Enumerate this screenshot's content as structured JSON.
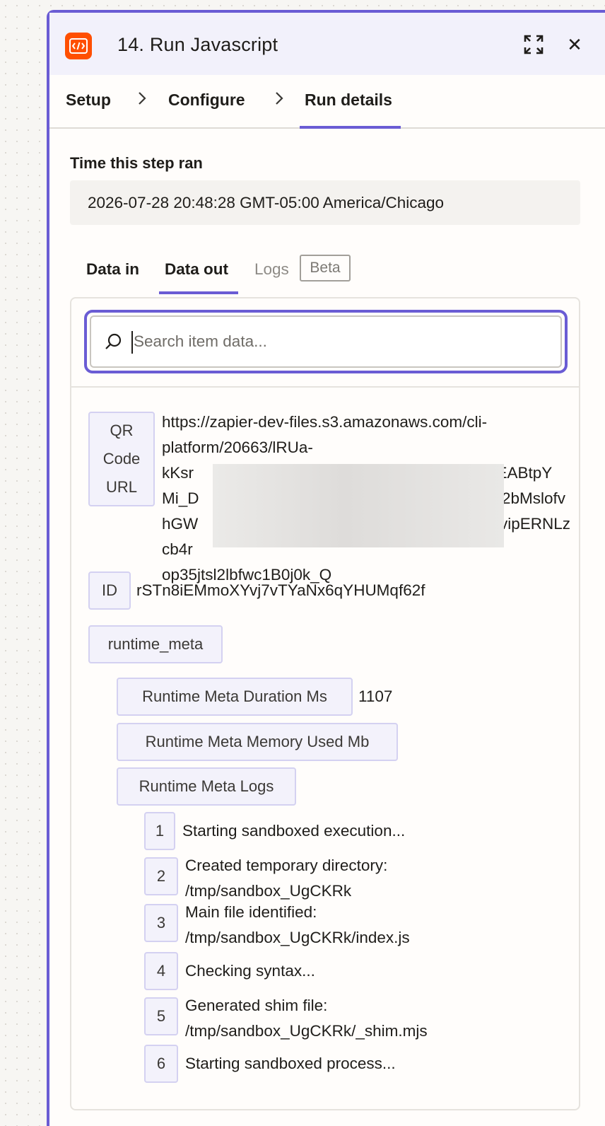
{
  "header": {
    "title": "14. Run Javascript",
    "close_glyph": "✕",
    "app_icon": "code-icon",
    "accent": "#6a5cd4",
    "brand": "#ff4f00"
  },
  "steps": [
    {
      "label": "Setup"
    },
    {
      "label": "Configure"
    },
    {
      "label": "Run details",
      "active": true
    }
  ],
  "run": {
    "time_label": "Time this step ran",
    "time_value": "2026-07-28 20:48:28 GMT-05:00 America/Chicago"
  },
  "data_tabs": {
    "data_in": "Data in",
    "data_out": "Data out",
    "logs": "Logs",
    "beta": "Beta",
    "active": "data_out"
  },
  "search": {
    "placeholder": "Search item data..."
  },
  "items": {
    "qr_key_lines": [
      "QR",
      "Code",
      "URL"
    ],
    "qr_value_lines": [
      "https://zapier-dev-files.s3.amazonaws.com/cli-",
      "platform/20663/lRUa-",
      "kKsr",
      "Mi_D",
      "hGW",
      "cb4r",
      "op35jtsl2lbfwc1B0j0k_Q"
    ],
    "qr_value_right": [
      "laEABtpY",
      "l2bMslofv",
      "vipERNLz"
    ],
    "id_key": "ID",
    "id_value": "rSTn8iEMmoXYvj7vTYaNx6qYHUMqf62f",
    "runtime_key": "runtime_meta",
    "duration_key": "Runtime Meta Duration Ms",
    "duration_value": "1107",
    "memory_key": "Runtime Meta Memory Used Mb",
    "logs_key": "Runtime Meta Logs",
    "logs": [
      {
        "index": "1",
        "lines": [
          "Starting sandboxed execution..."
        ]
      },
      {
        "index": "2",
        "lines": [
          "Created temporary directory:",
          "/tmp/sandbox_UgCKRk"
        ]
      },
      {
        "index": "3",
        "lines": [
          "Main file identified:",
          "/tmp/sandbox_UgCKRk/index.js"
        ]
      },
      {
        "index": "4",
        "lines": [
          "Checking syntax..."
        ]
      },
      {
        "index": "5",
        "lines": [
          "Generated shim file:",
          "/tmp/sandbox_UgCKRk/_shim.mjs"
        ]
      },
      {
        "index": "6",
        "lines": [
          "Starting sandboxed process..."
        ]
      }
    ]
  }
}
